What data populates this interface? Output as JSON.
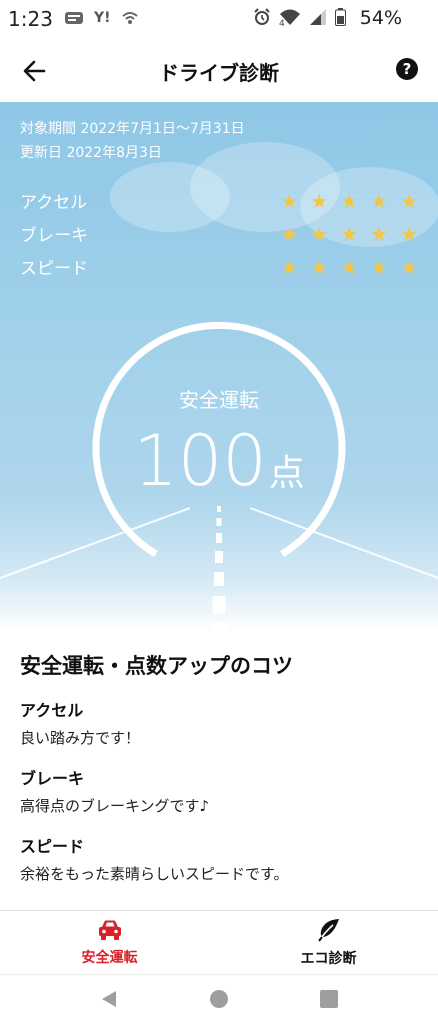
{
  "status_bar": {
    "time": "1:23",
    "left_icons": [
      "news-icon",
      "Y!",
      "wifi-calling-icon"
    ],
    "right_icons": [
      "alarm-icon",
      "wifi-icon",
      "signal-icon",
      "battery-icon"
    ],
    "wifi_badge": "4",
    "battery_percent": "54%"
  },
  "app_bar": {
    "title": "ドライブ診断",
    "back_icon": "arrow-left-icon",
    "help_icon": "question-icon",
    "help_symbol": "?"
  },
  "summary": {
    "period": "対象期間 2022年7月1日〜7月31日",
    "updated": "更新日 2022年8月3日",
    "star_color": "#f2c649",
    "ratings": [
      {
        "label": "アクセル",
        "stars": 5
      },
      {
        "label": "ブレーキ",
        "stars": 5
      },
      {
        "label": "スピード",
        "stars": 5
      }
    ]
  },
  "score": {
    "label": "安全運転",
    "value": "100",
    "unit": "点"
  },
  "tips": {
    "title": "安全運転・点数アップのコツ",
    "items": [
      {
        "label": "アクセル",
        "text": "良い踏み方です！"
      },
      {
        "label": "ブレーキ",
        "text": "高得点のブレーキングです♪"
      },
      {
        "label": "スピード",
        "text": "余裕をもった素晴らしいスピードです。"
      }
    ]
  },
  "bottom_nav": {
    "active_color": "#d8222a",
    "items": [
      {
        "label": "安全運転",
        "icon": "car-icon",
        "active": true
      },
      {
        "label": "エコ診断",
        "icon": "leaf-icon",
        "active": false
      }
    ]
  },
  "system_nav": [
    "back-triangle-icon",
    "home-circle-icon",
    "recents-square-icon"
  ]
}
